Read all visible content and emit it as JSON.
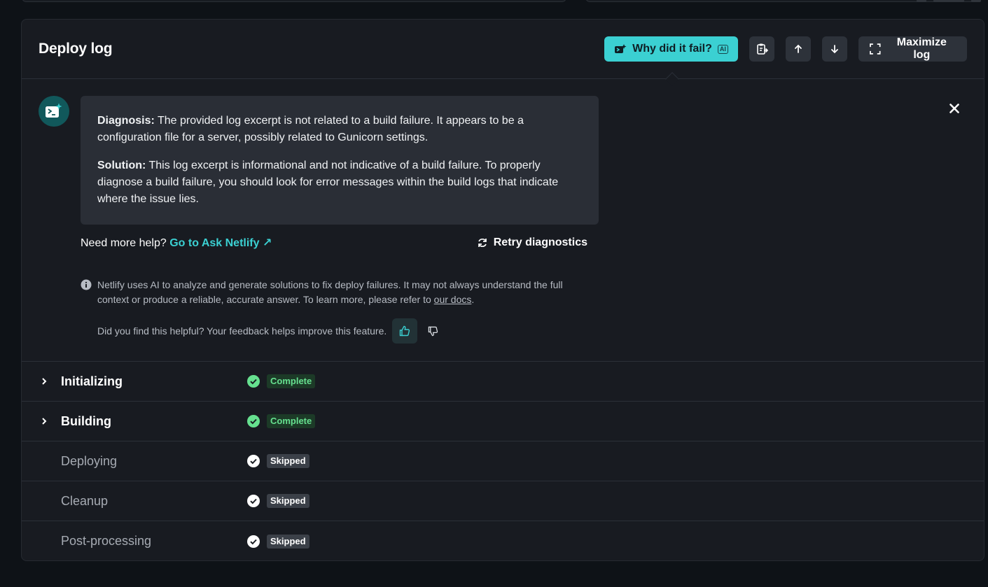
{
  "header": {
    "title": "Deploy log",
    "why_fail_label": "Why did it fail?",
    "ai_badge": "AI",
    "maximize_label": "Maximize log"
  },
  "diagnosis": {
    "diagnosis_label": "Diagnosis:",
    "diagnosis_text": " The provided log excerpt is not related to a build failure. It appears to be a configuration file for a server, possibly related to Gunicorn settings.",
    "solution_label": "Solution:",
    "solution_text": " This log excerpt is informational and not indicative of a build failure. To properly diagnose a build failure, you should look for error messages within the build logs that indicate where the issue lies."
  },
  "help": {
    "prompt": "Need more help?",
    "link_label": "Go to Ask Netlify",
    "link_arrow": "↗",
    "retry_label": "Retry diagnostics"
  },
  "disclaimer": {
    "text": "Netlify uses AI to analyze and generate solutions to fix deploy failures. It may not always understand the full context or produce a reliable, accurate answer. To learn more, please refer to ",
    "link_label": "our docs",
    "end": "."
  },
  "feedback": {
    "question": "Did you find this helpful? Your feedback helps improve this feature."
  },
  "steps": [
    {
      "name": "Initializing",
      "status": "Complete"
    },
    {
      "name": "Building",
      "status": "Complete"
    },
    {
      "name": "Deploying",
      "status": "Skipped"
    },
    {
      "name": "Cleanup",
      "status": "Skipped"
    },
    {
      "name": "Post-processing",
      "status": "Skipped"
    }
  ],
  "colors": {
    "accent": "#3bd0d2",
    "complete_green": "#66e08f",
    "panel_bg": "#181b21",
    "page_bg": "#0e1217"
  }
}
